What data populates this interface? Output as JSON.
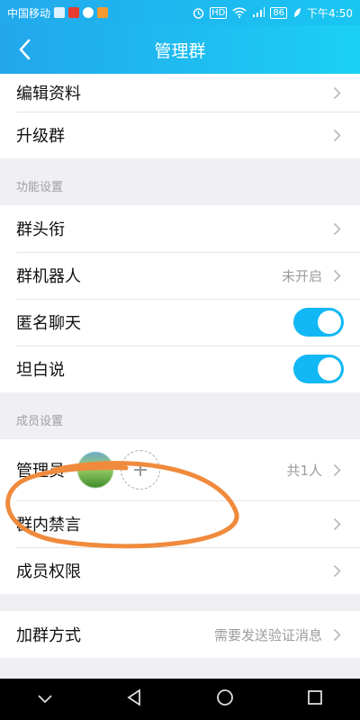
{
  "status_bar": {
    "carrier": "中国移动",
    "battery": "86",
    "time": "下午4:50"
  },
  "header": {
    "title": "管理群"
  },
  "rows": {
    "edit_profile": "编辑资料",
    "upgrade_group": "升级群"
  },
  "function_section": {
    "title": "功能设置",
    "group_title": "群头衔",
    "robot": "群机器人",
    "robot_status": "未开启",
    "anonymous_chat": "匿名聊天",
    "anonymous_chat_on": true,
    "tanbai": "坦白说",
    "tanbai_on": true
  },
  "member_section": {
    "title": "成员设置",
    "admins": "管理员",
    "admin_count": "共1人",
    "mute": "群内禁言",
    "permissions": "成员权限"
  },
  "join": {
    "label": "加群方式",
    "value": "需要发送验证消息"
  },
  "colors": {
    "header": "#1fb6f0",
    "toggle_on": "#12b7f5",
    "annotation": "#f08a3c"
  }
}
